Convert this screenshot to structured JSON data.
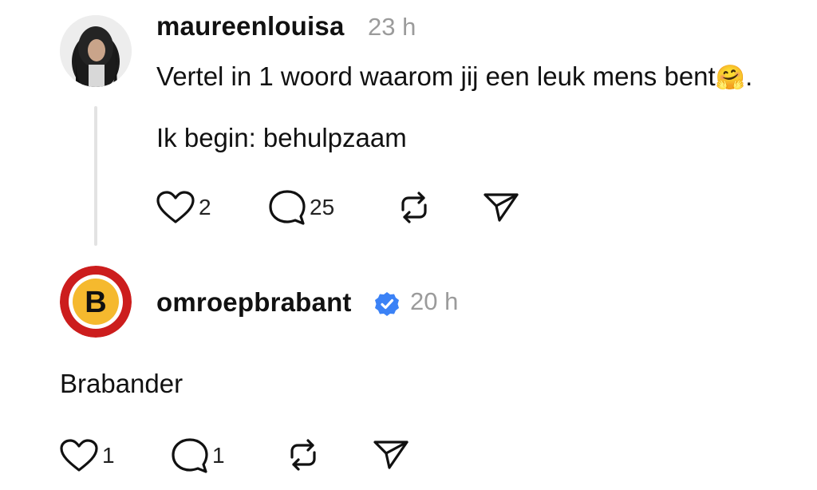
{
  "posts": [
    {
      "username": "maureenlouisa",
      "time": "23 h",
      "text_line1": "Vertel in 1 woord waarom jij een leuk mens bent",
      "text_emoji": "🤗",
      "text_end": ".",
      "text_line2": "Ik begin: behulpzaam",
      "likes": "2",
      "replies": "25",
      "verified": false
    },
    {
      "username": "omroepbrabant",
      "time": "20 h",
      "avatar_letter": "B",
      "text": "Brabander",
      "likes": "1",
      "replies": "1",
      "verified": true
    }
  ],
  "colors": {
    "verified_badge": "#3b82f6",
    "logo_red": "#cc1d1d",
    "logo_yellow": "#f5b92e",
    "timestamp": "#9b9b9b"
  },
  "icons": [
    "heart-icon",
    "comment-icon",
    "repost-icon",
    "share-icon",
    "verified-badge-icon"
  ]
}
